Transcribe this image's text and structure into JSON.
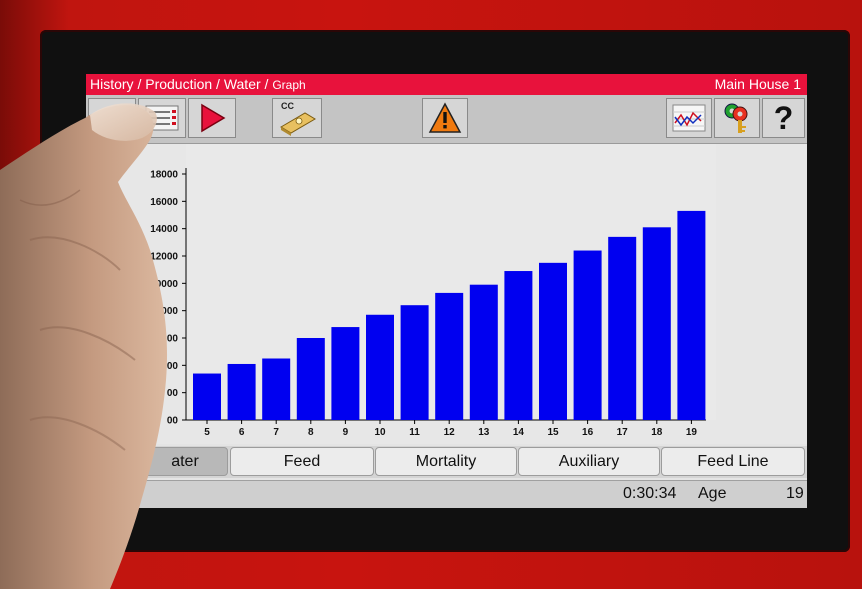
{
  "header": {
    "breadcrumb_main": "History / Production / Water / ",
    "breadcrumb_sub": "Graph",
    "house": "Main House 1"
  },
  "toolbar": {
    "cc_label": "CC",
    "help_label": "?"
  },
  "tabs": [
    {
      "label": "ater",
      "active": true
    },
    {
      "label": "Feed",
      "active": false
    },
    {
      "label": "Mortality",
      "active": false
    },
    {
      "label": "Auxiliary",
      "active": false
    },
    {
      "label": "Feed Line",
      "active": false
    }
  ],
  "status": {
    "time": "0:30:34",
    "age_label": "Age",
    "age_value": "19"
  },
  "chart_data": {
    "type": "bar",
    "categories": [
      "5",
      "6",
      "7",
      "8",
      "9",
      "10",
      "11",
      "12",
      "13",
      "14",
      "15",
      "16",
      "17",
      "18",
      "19"
    ],
    "values": [
      3400,
      4100,
      4500,
      6000,
      6800,
      7700,
      8400,
      9300,
      9900,
      10900,
      11500,
      12400,
      13400,
      14100,
      15300
    ],
    "ylim": [
      0,
      18000
    ],
    "yticks": [
      "18000",
      "16000",
      "14000",
      "12000",
      "10000",
      "8000",
      "000",
      "000",
      "00",
      "00",
      "0"
    ],
    "color": "#0000f0",
    "grid": false
  },
  "colors": {
    "titlebar": "#e8123c",
    "bars": "#0000f0",
    "frame": "#c8140f"
  }
}
